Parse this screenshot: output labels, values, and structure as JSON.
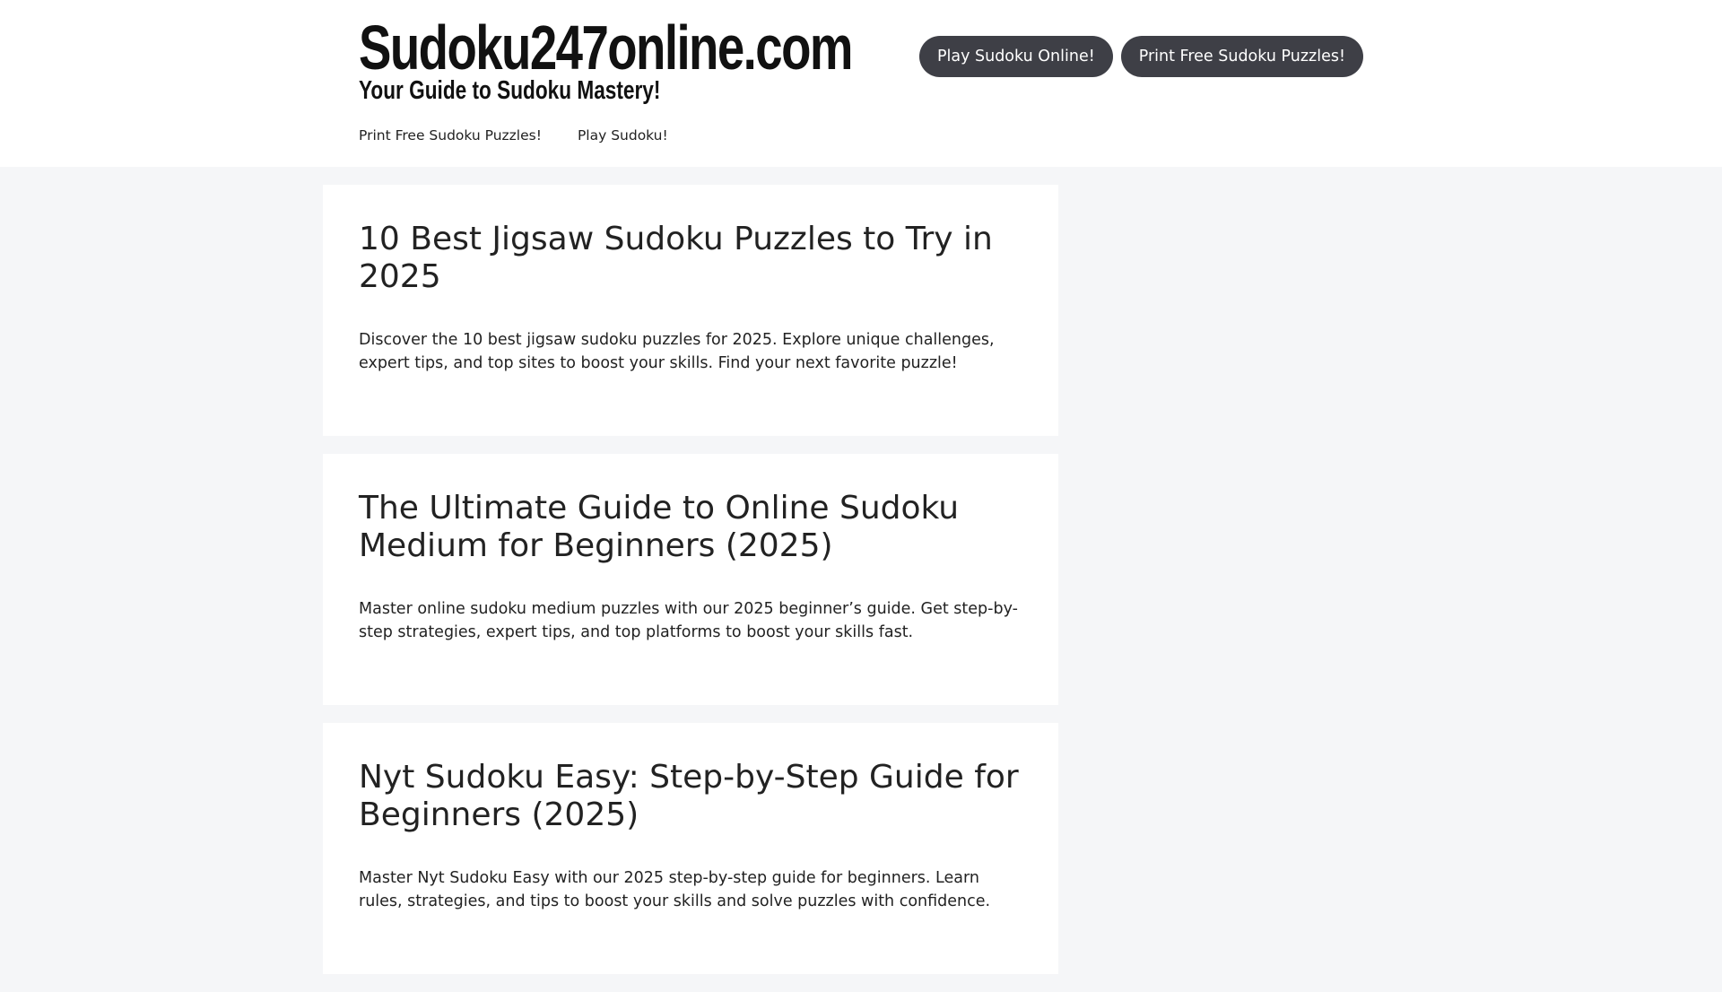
{
  "header": {
    "site_title": "Sudoku247online.com",
    "tagline": "Your Guide to Sudoku Mastery!",
    "buttons": [
      {
        "label": "Play Sudoku Online!"
      },
      {
        "label": "Print Free Sudoku Puzzles!"
      }
    ]
  },
  "nav": {
    "items": [
      {
        "label": "Print Free Sudoku Puzzles!"
      },
      {
        "label": "Play Sudoku!"
      }
    ]
  },
  "posts": [
    {
      "title": "10 Best Jigsaw Sudoku Puzzles to Try in 2025",
      "excerpt": "Discover the 10 best jigsaw sudoku puzzles for 2025. Explore unique challenges, expert tips, and top sites to boost your skills. Find your next favorite puzzle!"
    },
    {
      "title": "The Ultimate Guide to Online Sudoku Medium for Beginners (2025)",
      "excerpt": "Master online sudoku medium puzzles with our 2025 beginner’s guide. Get step-by-step strategies, expert tips, and top platforms to boost your skills fast."
    },
    {
      "title": "Nyt Sudoku Easy: Step-by-Step Guide for Beginners (2025)",
      "excerpt": "Master Nyt Sudoku Easy with our 2025 step-by-step guide for beginners. Learn rules, strategies, and tips to boost your skills and solve puzzles with confidence."
    }
  ],
  "colors": {
    "page_background": "#f5f6f8",
    "card_background": "#ffffff",
    "button_background": "#3e3f46",
    "button_text": "#ffffff",
    "text": "#222222"
  }
}
